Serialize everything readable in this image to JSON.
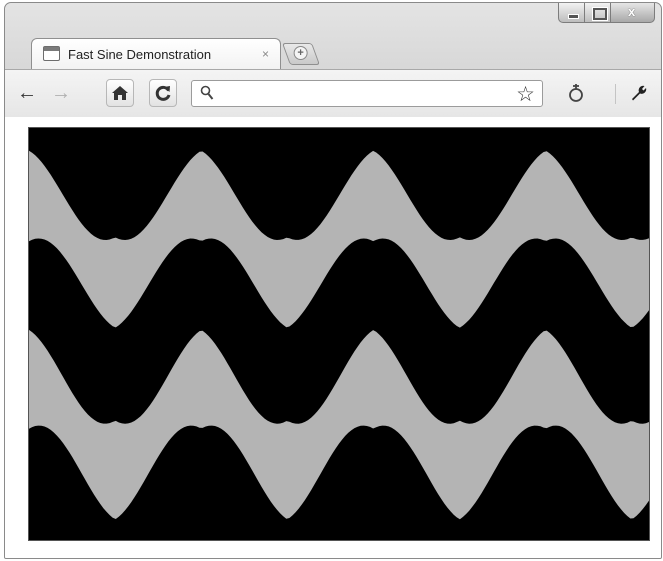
{
  "window": {
    "controls": {
      "close_glyph": "x"
    }
  },
  "tab": {
    "title": "Fast Sine Demonstration",
    "close_glyph": "×",
    "new_tab_glyph": "+"
  },
  "toolbar": {
    "back_glyph": "←",
    "forward_glyph": "→",
    "home_glyph": "⌂",
    "reload_glyph": "↻",
    "address_value": "",
    "star_glyph": "☆"
  },
  "page": {
    "canvas_background": "#000000",
    "wave_color": "#b4b4b4",
    "wave": {
      "cycles": 3.6,
      "upper_band": {
        "center": 0.27,
        "amplitude": 0.21,
        "thickness": 0.22
      },
      "lower_band": {
        "center": 0.72,
        "amplitude": 0.22,
        "thickness": 0.24
      }
    }
  },
  "icons": [
    "back-arrow-icon",
    "forward-arrow-icon",
    "home-icon",
    "reload-icon",
    "search-icon",
    "bookmark-star-icon",
    "page-action-icon",
    "wrench-icon",
    "favicon-icon"
  ]
}
